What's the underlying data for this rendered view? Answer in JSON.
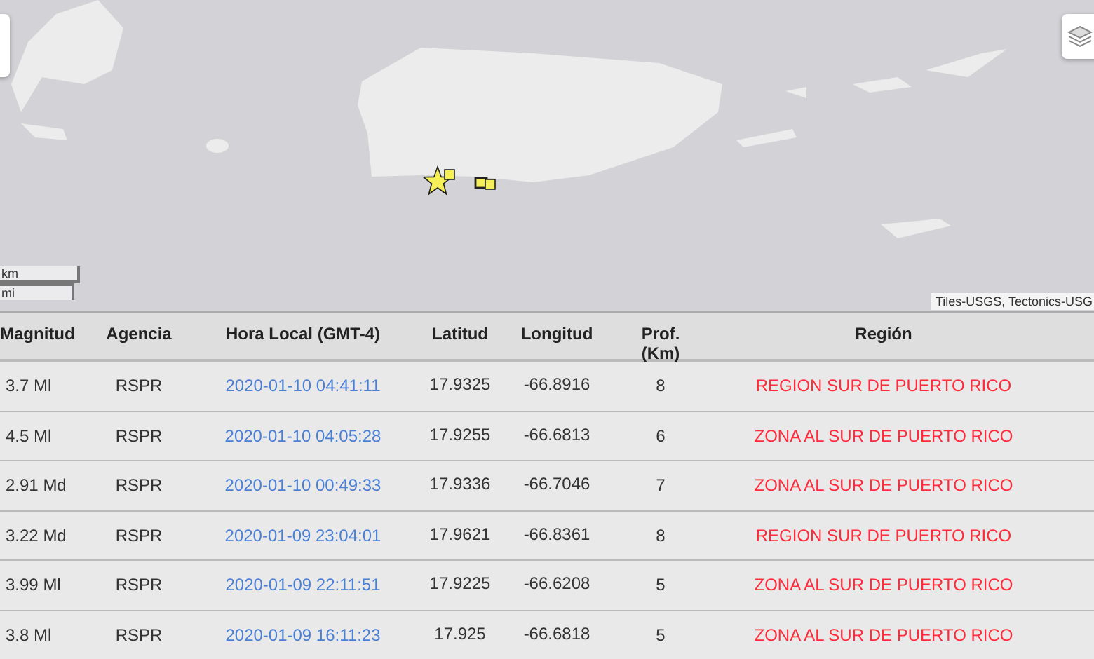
{
  "map": {
    "scale": [
      "km",
      "mi"
    ],
    "attribution": "Tiles-USGS, Tectonics-USG"
  },
  "table": {
    "columns": [
      "Magnitud",
      "Agencia",
      "Hora Local (GMT-4)",
      "Latitud",
      "Longitud",
      "Prof. (Km)",
      "Región"
    ],
    "rows": [
      {
        "magnitude": "3.7 Ml",
        "agency": "RSPR",
        "time": "2020-01-10 04:41:11",
        "lat": "17.9325",
        "lon": "-66.8916",
        "depth": "8",
        "region": "REGION SUR DE PUERTO RICO"
      },
      {
        "magnitude": "4.5 Ml",
        "agency": "RSPR",
        "time": "2020-01-10 04:05:28",
        "lat": "17.9255",
        "lon": "-66.6813",
        "depth": "6",
        "region": "ZONA AL SUR DE PUERTO RICO"
      },
      {
        "magnitude": "2.91 Md",
        "agency": "RSPR",
        "time": "2020-01-10 00:49:33",
        "lat": "17.9336",
        "lon": "-66.7046",
        "depth": "7",
        "region": "ZONA AL SUR DE PUERTO RICO"
      },
      {
        "magnitude": "3.22 Md",
        "agency": "RSPR",
        "time": "2020-01-09 23:04:01",
        "lat": "17.9621",
        "lon": "-66.8361",
        "depth": "8",
        "region": "REGION SUR DE PUERTO RICO"
      },
      {
        "magnitude": "3.99 Ml",
        "agency": "RSPR",
        "time": "2020-01-09 22:11:51",
        "lat": "17.9225",
        "lon": "-66.6208",
        "depth": "5",
        "region": "ZONA AL SUR DE PUERTO RICO"
      },
      {
        "magnitude": "3.8 Ml",
        "agency": "RSPR",
        "time": "2020-01-09 16:11:23",
        "lat": "17.925",
        "lon": "-66.6818",
        "depth": "5",
        "region": "ZONA AL SUR DE PUERTO RICO"
      }
    ]
  }
}
